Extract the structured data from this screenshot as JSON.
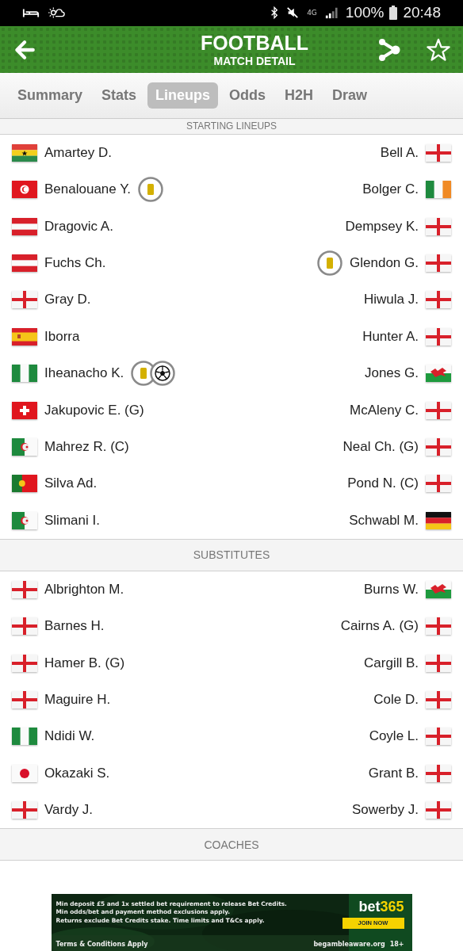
{
  "status_bar": {
    "network": "4G",
    "battery": "100%",
    "time": "20:48"
  },
  "header": {
    "title": "FOOTBALL",
    "subtitle": "MATCH DETAIL"
  },
  "tabs": [
    {
      "label": "Summary",
      "selected": false
    },
    {
      "label": "Stats",
      "selected": false
    },
    {
      "label": "Lineups",
      "selected": true
    },
    {
      "label": "Odds",
      "selected": false
    },
    {
      "label": "H2H",
      "selected": false
    },
    {
      "label": "Draw",
      "selected": false
    }
  ],
  "sections": [
    {
      "title": "STARTING LINEUPS",
      "rows": [
        {
          "home": {
            "name": "Amartey D.",
            "flag": {
              "kind": "ghana"
            }
          },
          "away": {
            "name": "Bell A.",
            "flag": {
              "kind": "england"
            }
          }
        },
        {
          "home": {
            "name": "Benalouane Y.",
            "flag": {
              "kind": "tunisia"
            },
            "events": [
              {
                "kind": "card"
              }
            ]
          },
          "away": {
            "name": "Bolger C.",
            "flag": {
              "kind": "ireland"
            }
          }
        },
        {
          "home": {
            "name": "Dragovic A.",
            "flag": {
              "kind": "austria"
            }
          },
          "away": {
            "name": "Dempsey K.",
            "flag": {
              "kind": "england"
            }
          }
        },
        {
          "home": {
            "name": "Fuchs Ch.",
            "flag": {
              "kind": "austria"
            }
          },
          "away": {
            "name": "Glendon G.",
            "flag": {
              "kind": "england"
            },
            "events": [
              {
                "kind": "card"
              }
            ]
          }
        },
        {
          "home": {
            "name": "Gray D.",
            "flag": {
              "kind": "england"
            }
          },
          "away": {
            "name": "Hiwula J.",
            "flag": {
              "kind": "england"
            }
          }
        },
        {
          "home": {
            "name": "Iborra",
            "flag": {
              "kind": "spain"
            }
          },
          "away": {
            "name": "Hunter A.",
            "flag": {
              "kind": "england"
            }
          }
        },
        {
          "home": {
            "name": "Iheanacho K.",
            "flag": {
              "kind": "nigeria"
            },
            "events": [
              {
                "kind": "card"
              },
              {
                "kind": "goal"
              }
            ]
          },
          "away": {
            "name": "Jones G.",
            "flag": {
              "kind": "wales"
            }
          }
        },
        {
          "home": {
            "name": "Jakupovic E. (G)",
            "flag": {
              "kind": "switzerland"
            }
          },
          "away": {
            "name": "McAleny C.",
            "flag": {
              "kind": "england"
            }
          }
        },
        {
          "home": {
            "name": "Mahrez R. (C)",
            "flag": {
              "kind": "algeria"
            }
          },
          "away": {
            "name": "Neal Ch. (G)",
            "flag": {
              "kind": "england"
            }
          }
        },
        {
          "home": {
            "name": "Silva Ad.",
            "flag": {
              "kind": "portugal"
            }
          },
          "away": {
            "name": "Pond N. (C)",
            "flag": {
              "kind": "england"
            }
          }
        },
        {
          "home": {
            "name": "Slimani I.",
            "flag": {
              "kind": "algeria"
            }
          },
          "away": {
            "name": "Schwabl M.",
            "flag": {
              "kind": "germany"
            }
          }
        }
      ]
    },
    {
      "title": "SUBSTITUTES",
      "rows": [
        {
          "home": {
            "name": "Albrighton M.",
            "flag": {
              "kind": "england"
            }
          },
          "away": {
            "name": "Burns W.",
            "flag": {
              "kind": "wales"
            }
          }
        },
        {
          "home": {
            "name": "Barnes H.",
            "flag": {
              "kind": "england"
            }
          },
          "away": {
            "name": "Cairns A. (G)",
            "flag": {
              "kind": "england"
            }
          }
        },
        {
          "home": {
            "name": "Hamer B. (G)",
            "flag": {
              "kind": "england"
            }
          },
          "away": {
            "name": "Cargill B.",
            "flag": {
              "kind": "england"
            }
          }
        },
        {
          "home": {
            "name": "Maguire H.",
            "flag": {
              "kind": "england"
            }
          },
          "away": {
            "name": "Cole D.",
            "flag": {
              "kind": "england"
            }
          }
        },
        {
          "home": {
            "name": "Ndidi W.",
            "flag": {
              "kind": "nigeria"
            }
          },
          "away": {
            "name": "Coyle L.",
            "flag": {
              "kind": "england"
            }
          }
        },
        {
          "home": {
            "name": "Okazaki S.",
            "flag": {
              "kind": "japan"
            }
          },
          "away": {
            "name": "Grant B.",
            "flag": {
              "kind": "england"
            }
          }
        },
        {
          "home": {
            "name": "Vardy J.",
            "flag": {
              "kind": "england"
            }
          },
          "away": {
            "name": "Sowerby J.",
            "flag": {
              "kind": "england"
            }
          }
        }
      ]
    },
    {
      "title": "COACHES"
    }
  ],
  "ad": {
    "lines": [
      "Min deposit £5 and 1x settled bet requirement to release Bet Credits.",
      "Min odds/bet and payment method exclusions apply.",
      "Returns exclude Bet Credits stake. Time limits and T&Cs apply."
    ],
    "footer": "Terms & Conditions Apply",
    "brand": [
      "bet",
      "365"
    ],
    "button": "JOIN NOW",
    "aware": "begambleaware.org",
    "age": "18+"
  }
}
